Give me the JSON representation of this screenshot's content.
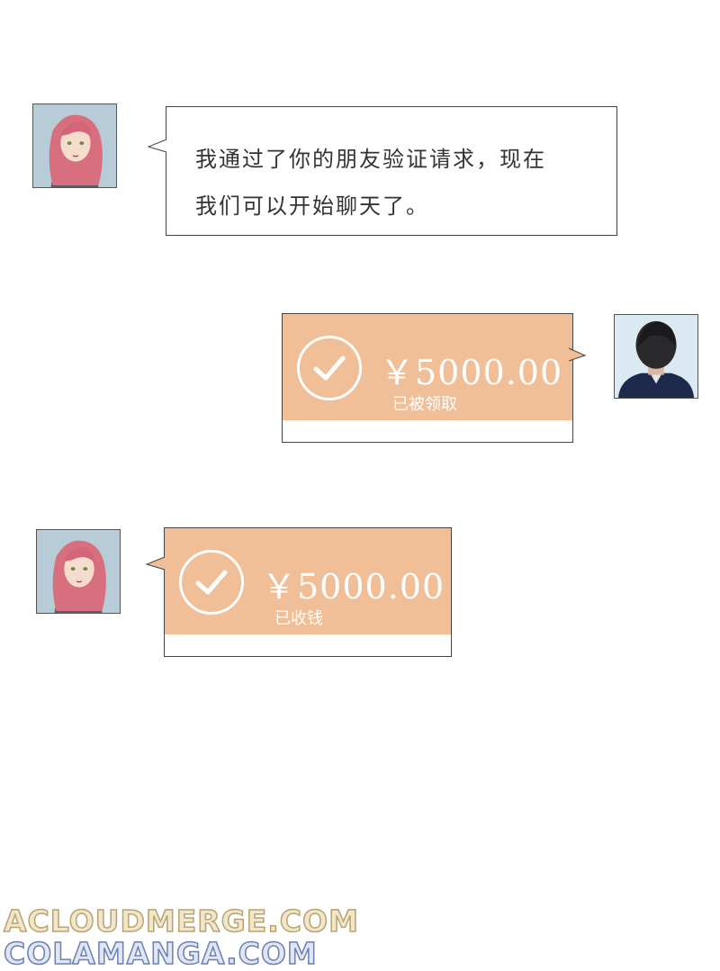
{
  "messages": [
    {
      "sender": "girl",
      "type": "text",
      "text_lines": [
        "我通过了你的朋友验证请求，现在",
        "我们可以开始聊天了。"
      ]
    },
    {
      "sender": "boy",
      "type": "transfer",
      "amount": "￥5000.00",
      "status": "已被领取"
    },
    {
      "sender": "girl",
      "type": "transfer",
      "amount": "￥5000.00",
      "status": "已收钱"
    }
  ],
  "watermark": {
    "line1": "ACLOUDMERGE.COM",
    "line2": "COLAMANGA.COM"
  },
  "colors": {
    "transfer_orange": "#f0be97",
    "border": "#444444",
    "avatar_bg_girl": "#b5cbd6",
    "avatar_bg_boy": "#dbe9f2"
  }
}
